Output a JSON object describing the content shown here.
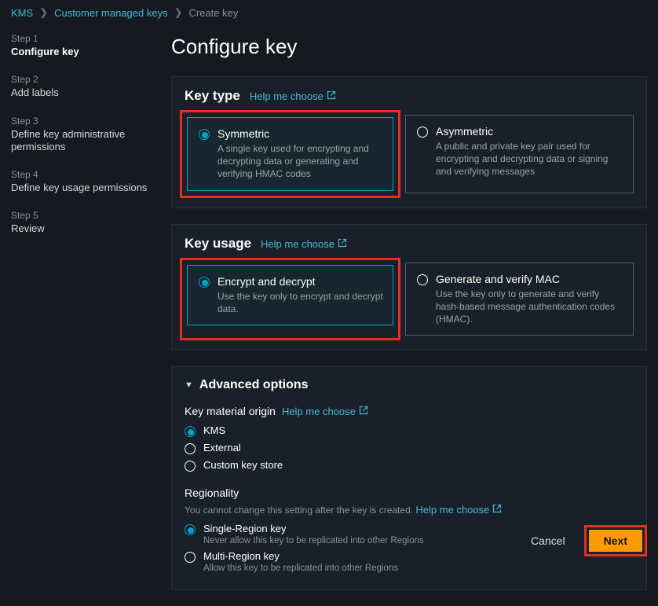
{
  "breadcrumb": {
    "root": "KMS",
    "mid": "Customer managed keys",
    "current": "Create key"
  },
  "steps": [
    {
      "label": "Step 1",
      "title": "Configure key",
      "active": true
    },
    {
      "label": "Step 2",
      "title": "Add labels"
    },
    {
      "label": "Step 3",
      "title": "Define key administrative permissions"
    },
    {
      "label": "Step 4",
      "title": "Define key usage permissions"
    },
    {
      "label": "Step 5",
      "title": "Review"
    }
  ],
  "page": {
    "title": "Configure key"
  },
  "help": "Help me choose",
  "key_type": {
    "heading": "Key type",
    "options": [
      {
        "title": "Symmetric",
        "desc": "A single key used for encrypting and decrypting data or generating and verifying HMAC codes",
        "selected": true
      },
      {
        "title": "Asymmetric",
        "desc": "A public and private key pair used for encrypting and decrypting data or signing and verifying messages",
        "selected": false
      }
    ]
  },
  "key_usage": {
    "heading": "Key usage",
    "options": [
      {
        "title": "Encrypt and decrypt",
        "desc": "Use the key only to encrypt and decrypt data.",
        "selected": true
      },
      {
        "title": "Generate and verify MAC",
        "desc": "Use the key only to generate and verify hash-based message authentication codes (HMAC).",
        "selected": false
      }
    ]
  },
  "advanced": {
    "heading": "Advanced options",
    "origin": {
      "label": "Key material origin",
      "options": [
        {
          "label": "KMS",
          "selected": true
        },
        {
          "label": "External",
          "selected": false
        },
        {
          "label": "Custom key store",
          "selected": false
        }
      ]
    },
    "regionality": {
      "label": "Regionality",
      "note": "You cannot change this setting after the key is created.",
      "options": [
        {
          "label": "Single-Region key",
          "sub": "Never allow this key to be replicated into other Regions",
          "selected": true
        },
        {
          "label": "Multi-Region key",
          "sub": "Allow this key to be replicated into other Regions",
          "selected": false
        }
      ]
    }
  },
  "footer": {
    "cancel": "Cancel",
    "next": "Next"
  }
}
